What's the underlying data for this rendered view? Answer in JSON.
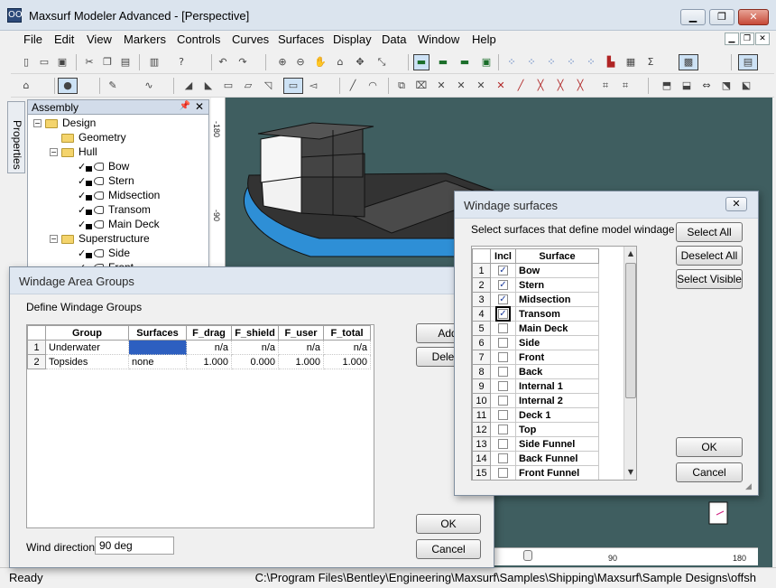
{
  "window": {
    "title": "Maxsurf Modeler Advanced - [Perspective]",
    "app_icon": "OO"
  },
  "menus": [
    "File",
    "Edit",
    "View",
    "Markers",
    "Controls",
    "Curves",
    "Surfaces",
    "Display",
    "Data",
    "Window",
    "Help"
  ],
  "side_tab": {
    "label": "Properties"
  },
  "assembly": {
    "title": "Assembly",
    "tree": [
      {
        "label": "Design",
        "type": "folder",
        "depth": 0,
        "expander": "−"
      },
      {
        "label": "Geometry",
        "type": "folder",
        "depth": 1,
        "expander": ""
      },
      {
        "label": "Hull",
        "type": "folder",
        "depth": 1,
        "expander": "−"
      },
      {
        "label": "Bow",
        "type": "surface",
        "depth": 2,
        "expander": ""
      },
      {
        "label": "Stern",
        "type": "surface",
        "depth": 2,
        "expander": ""
      },
      {
        "label": "Midsection",
        "type": "surface",
        "depth": 2,
        "expander": ""
      },
      {
        "label": "Transom",
        "type": "surface",
        "depth": 2,
        "expander": ""
      },
      {
        "label": "Main Deck",
        "type": "surface",
        "depth": 2,
        "expander": ""
      },
      {
        "label": "Superstructure",
        "type": "folder",
        "depth": 1,
        "expander": "−"
      },
      {
        "label": "Side",
        "type": "surface",
        "depth": 2,
        "expander": ""
      },
      {
        "label": "Front",
        "type": "surface",
        "depth": 2,
        "expander": ""
      }
    ]
  },
  "viewport": {
    "ruler_left": [
      "-180",
      "-90"
    ],
    "ruler_bottom": [
      "90",
      "180"
    ]
  },
  "status": {
    "left": "Ready",
    "path": "C:\\Program Files\\Bentley\\Engineering\\Maxsurf\\Samples\\Shipping\\Maxsurf\\Sample Designs\\offsh"
  },
  "windage_groups": {
    "title": "Windage Area Groups",
    "subtitle": "Define Windage Groups",
    "columns": [
      "Group",
      "Surfaces",
      "F_drag",
      "F_shield",
      "F_user",
      "F_total"
    ],
    "rows": [
      {
        "num": "1",
        "group": "Underwater",
        "surfaces": "",
        "f_drag": "n/a",
        "f_shield": "n/a",
        "f_user": "n/a",
        "f_total": "n/a"
      },
      {
        "num": "2",
        "group": "Topsides",
        "surfaces": "none",
        "f_drag": "1.000",
        "f_shield": "0.000",
        "f_user": "1.000",
        "f_total": "1.000"
      }
    ],
    "add_label": "Add",
    "delete_label": "Delete",
    "ok_label": "OK",
    "cancel_label": "Cancel",
    "wind_direction_label": "Wind direction",
    "wind_direction_value": "90 deg"
  },
  "windage_surfaces": {
    "title": "Windage surfaces",
    "instruction": "Select surfaces that define model windage",
    "columns": [
      "Incl",
      "Surface"
    ],
    "rows": [
      {
        "num": "1",
        "name": "Bow",
        "checked": true
      },
      {
        "num": "2",
        "name": "Stern",
        "checked": true
      },
      {
        "num": "3",
        "name": "Midsection",
        "checked": true
      },
      {
        "num": "4",
        "name": "Transom",
        "checked": true
      },
      {
        "num": "5",
        "name": "Main Deck",
        "checked": false
      },
      {
        "num": "6",
        "name": "Side",
        "checked": false
      },
      {
        "num": "7",
        "name": "Front",
        "checked": false
      },
      {
        "num": "8",
        "name": "Back",
        "checked": false
      },
      {
        "num": "9",
        "name": "Internal 1",
        "checked": false
      },
      {
        "num": "10",
        "name": "Internal 2",
        "checked": false
      },
      {
        "num": "11",
        "name": "Deck 1",
        "checked": false
      },
      {
        "num": "12",
        "name": "Top",
        "checked": false
      },
      {
        "num": "13",
        "name": "Side Funnel",
        "checked": false
      },
      {
        "num": "14",
        "name": "Back Funnel",
        "checked": false
      },
      {
        "num": "15",
        "name": "Front Funnel",
        "checked": false
      }
    ],
    "select_all_label": "Select All",
    "deselect_all_label": "Deselect All",
    "select_visible_label": "Select Visible",
    "ok_label": "OK",
    "cancel_label": "Cancel"
  },
  "colors": {
    "viewport_bg": "#3f5e60",
    "hull_blue": "#2e8fd6",
    "selection_blue": "#2d5fc0"
  }
}
